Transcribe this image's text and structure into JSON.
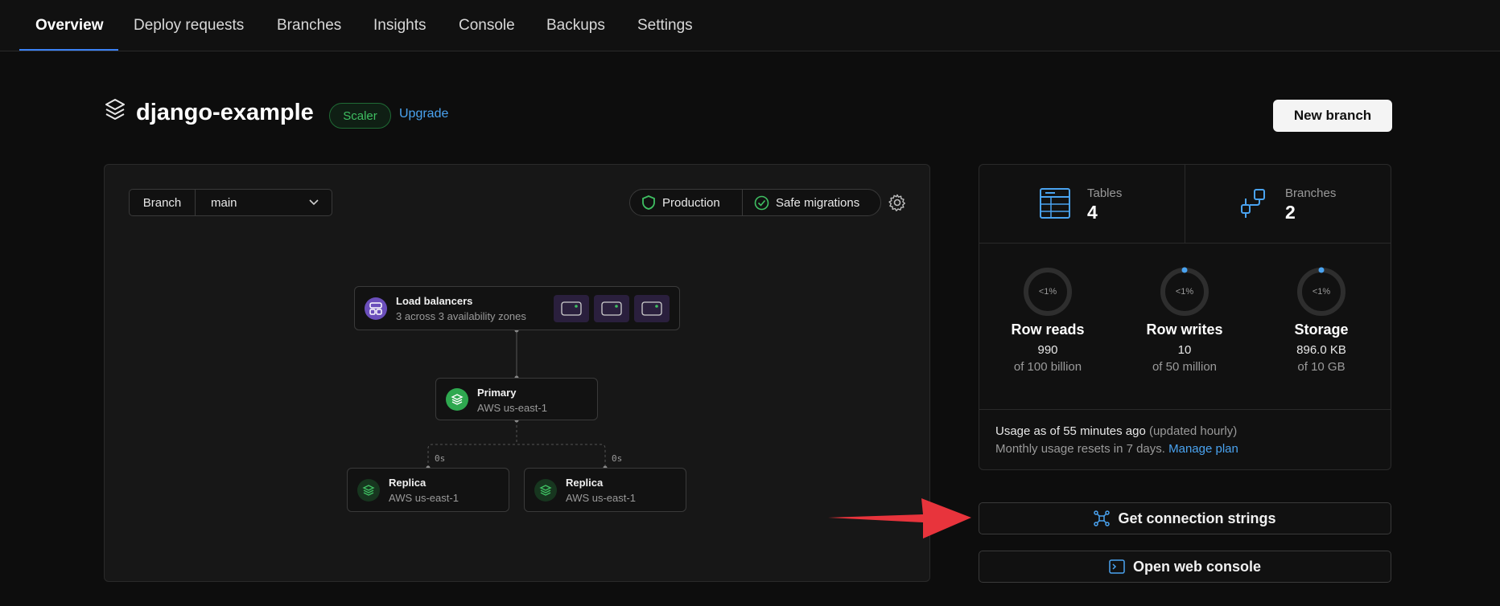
{
  "nav": {
    "tabs": [
      "Overview",
      "Deploy requests",
      "Branches",
      "Insights",
      "Console",
      "Backups",
      "Settings"
    ],
    "active": "Overview"
  },
  "project": {
    "name": "django-example",
    "plan": "Scaler",
    "upgrade_label": "Upgrade",
    "new_branch_label": "New branch"
  },
  "branch_selector": {
    "label": "Branch",
    "value": "main"
  },
  "status_pills": {
    "production": "Production",
    "safe_migrations": "Safe migrations"
  },
  "topology": {
    "load_balancers": {
      "title": "Load balancers",
      "subtitle": "3 across 3 availability zones"
    },
    "primary": {
      "title": "Primary",
      "subtitle": "AWS us-east-1"
    },
    "replicas": [
      {
        "title": "Replica",
        "subtitle": "AWS us-east-1",
        "lag": "0s"
      },
      {
        "title": "Replica",
        "subtitle": "AWS us-east-1",
        "lag": "0s"
      }
    ]
  },
  "stats": {
    "tables": {
      "label": "Tables",
      "count": "4"
    },
    "branches": {
      "label": "Branches",
      "count": "2"
    }
  },
  "usage": [
    {
      "ring": "<1%",
      "title": "Row reads",
      "value": "990",
      "of": "of 100 billion",
      "fraction": 0
    },
    {
      "ring": "<1%",
      "title": "Row writes",
      "value": "10",
      "of": "of 50 million",
      "fraction": 0.005
    },
    {
      "ring": "<1%",
      "title": "Storage",
      "value": "896.0 KB",
      "of": "of 10 GB",
      "fraction": 0.005
    }
  ],
  "usage_note": {
    "line1": "Usage as of 55 minutes ago",
    "line1_muted": "(updated hourly)",
    "line2": "Monthly usage resets in 7 days.",
    "manage_plan": "Manage plan"
  },
  "actions": {
    "connection_strings": "Get connection strings",
    "web_console": "Open web console"
  },
  "colors": {
    "accent_blue": "#3b82f6",
    "link_blue": "#4aa3f0",
    "green": "#3fbf62",
    "purple": "#6b4fbb",
    "annotation_red": "#e8343c"
  }
}
